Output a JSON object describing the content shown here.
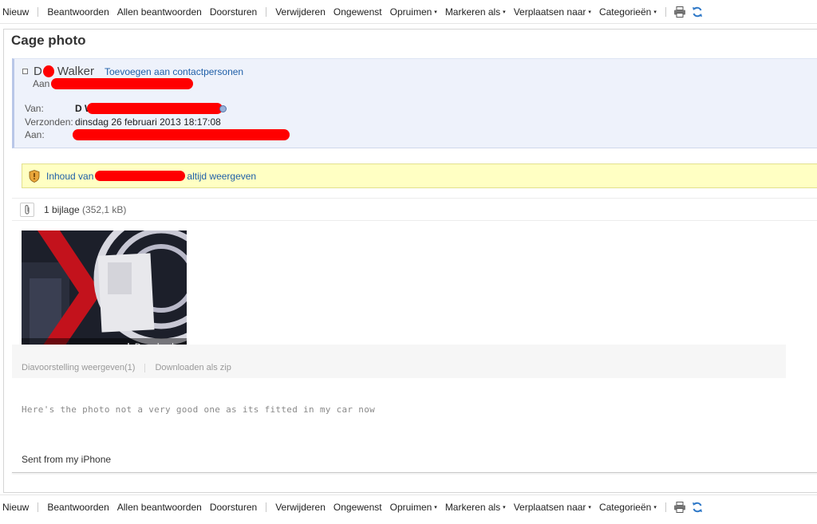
{
  "toolbar": {
    "items": [
      {
        "label": "Nieuw",
        "dropdown": false
      },
      {
        "label": "Beantwoorden",
        "dropdown": false
      },
      {
        "label": "Allen beantwoorden",
        "dropdown": false
      },
      {
        "label": "Doorsturen",
        "dropdown": false
      },
      {
        "label": "Verwijderen",
        "dropdown": false
      },
      {
        "label": "Ongewenst",
        "dropdown": false
      },
      {
        "label": "Opruimen",
        "dropdown": true
      },
      {
        "label": "Markeren als",
        "dropdown": true
      },
      {
        "label": "Verplaatsen naar",
        "dropdown": true
      },
      {
        "label": "Categorieën",
        "dropdown": true
      }
    ],
    "icons": [
      "printer-icon",
      "refresh-icon"
    ],
    "caret": "▾"
  },
  "message": {
    "subject": "Cage photo",
    "sender_initial": "D",
    "sender_name": "Walker",
    "add_contact": "Toevoegen aan contactpersonen",
    "aan_short_label": "Aan",
    "from_label": "Van:",
    "from_value": "D W",
    "sent_label": "Verzonden:",
    "sent_value": "dinsdag 26 februari 2013 18:17:08",
    "to_label": "Aan:"
  },
  "security": {
    "prefix": "Inhoud van",
    "suffix": "altijd weergeven"
  },
  "attachments": {
    "count_label": "1 bijlage",
    "size": "(352,1 kB)",
    "download_label": "Downloaden",
    "slideshow": "Diavoorstelling weergeven(1)",
    "download_zip": "Downloaden als zip"
  },
  "body": {
    "text": "Here's the photo not a very good one as its fitted in my car now",
    "signature": "Sent from my iPhone"
  },
  "colors": {
    "link": "#1f5fa8",
    "redaction": "#ff0000",
    "header_bg": "#eef2fb",
    "security_bg": "#ffffc3",
    "refresh_icon": "#2e78c7"
  }
}
